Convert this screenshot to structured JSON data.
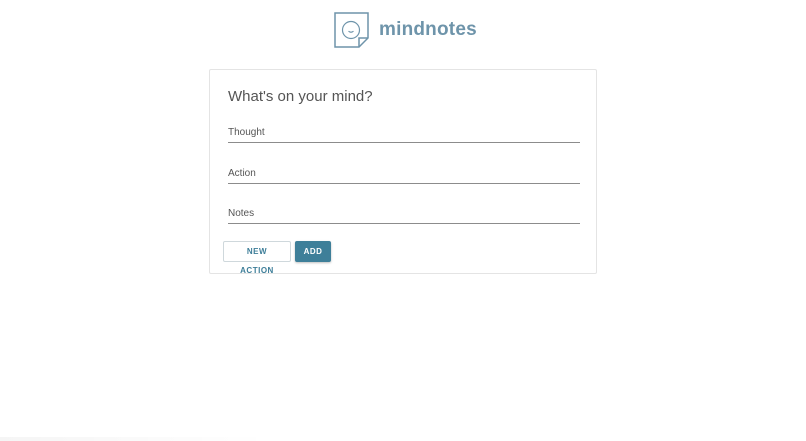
{
  "brand": {
    "name": "mindnotes",
    "logo_icon": "note-face-icon",
    "color": "#6e94aa"
  },
  "form": {
    "title": "What's on your mind?",
    "fields": {
      "thought": {
        "placeholder": "Thought",
        "value": ""
      },
      "action": {
        "placeholder": "Action",
        "value": ""
      },
      "notes": {
        "placeholder": "Notes",
        "value": ""
      }
    },
    "buttons": {
      "new_action": "NEW ACTION",
      "add": "ADD"
    },
    "accent_color": "#3e7f99"
  }
}
